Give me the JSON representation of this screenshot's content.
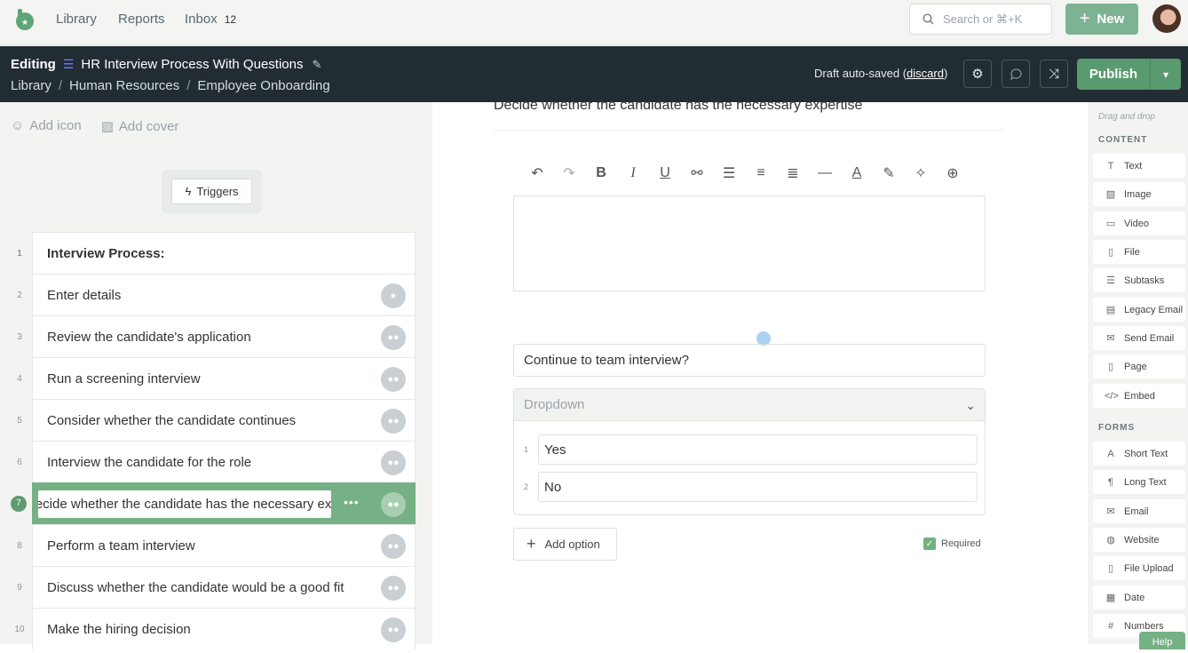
{
  "nav": {
    "links": [
      "Library",
      "Reports",
      "Inbox"
    ],
    "inbox_count": "12",
    "search_placeholder": "Search or ⌘+K",
    "new_label": "New"
  },
  "editbar": {
    "mode": "Editing",
    "title": "HR Interview Process With Questions",
    "breadcrumbs": [
      "Library",
      "Human Resources",
      "Employee Onboarding"
    ],
    "draft_text": "Draft auto-saved (",
    "discard": "discard",
    "draft_end": ")",
    "publish": "Publish"
  },
  "left": {
    "add_icon": "Add icon",
    "add_cover": "Add cover",
    "triggers": "Triggers",
    "tasks": [
      {
        "num": "1",
        "label": "Interview Process:"
      },
      {
        "num": "2",
        "label": "Enter details"
      },
      {
        "num": "3",
        "label": "Review the candidate's application"
      },
      {
        "num": "4",
        "label": "Run a screening interview"
      },
      {
        "num": "5",
        "label": "Consider whether the candidate continues"
      },
      {
        "num": "6",
        "label": "Interview the candidate for the role"
      },
      {
        "num": "7",
        "label": "Decide whether the candidate has the necessary expertise"
      },
      {
        "num": "8",
        "label": "Perform a team interview"
      },
      {
        "num": "9",
        "label": "Discuss whether the candidate would be a good fit"
      },
      {
        "num": "10",
        "label": "Make the hiring decision"
      }
    ]
  },
  "center": {
    "title": "Decide whether the candidate has the necessary expertise",
    "question": "Continue to team interview?",
    "dropdown_label": "Dropdown",
    "options": [
      {
        "num": "1",
        "label": "Yes"
      },
      {
        "num": "2",
        "label": "No"
      }
    ],
    "add_option": "Add option",
    "required": "Required"
  },
  "right": {
    "hint": "Drag and drop",
    "content_header": "CONTENT",
    "content_items": [
      "Text",
      "Image",
      "Video",
      "File",
      "Subtasks",
      "Legacy Email",
      "Send Email",
      "Page",
      "Embed"
    ],
    "forms_header": "FORMS",
    "form_items": [
      "Short Text",
      "Long Text",
      "Email",
      "Website",
      "File Upload",
      "Date",
      "Numbers"
    ],
    "help": "Help"
  },
  "colors": {
    "accent": "#76b085",
    "dark_bar": "#222c33",
    "publish": "#5a9a6f"
  }
}
